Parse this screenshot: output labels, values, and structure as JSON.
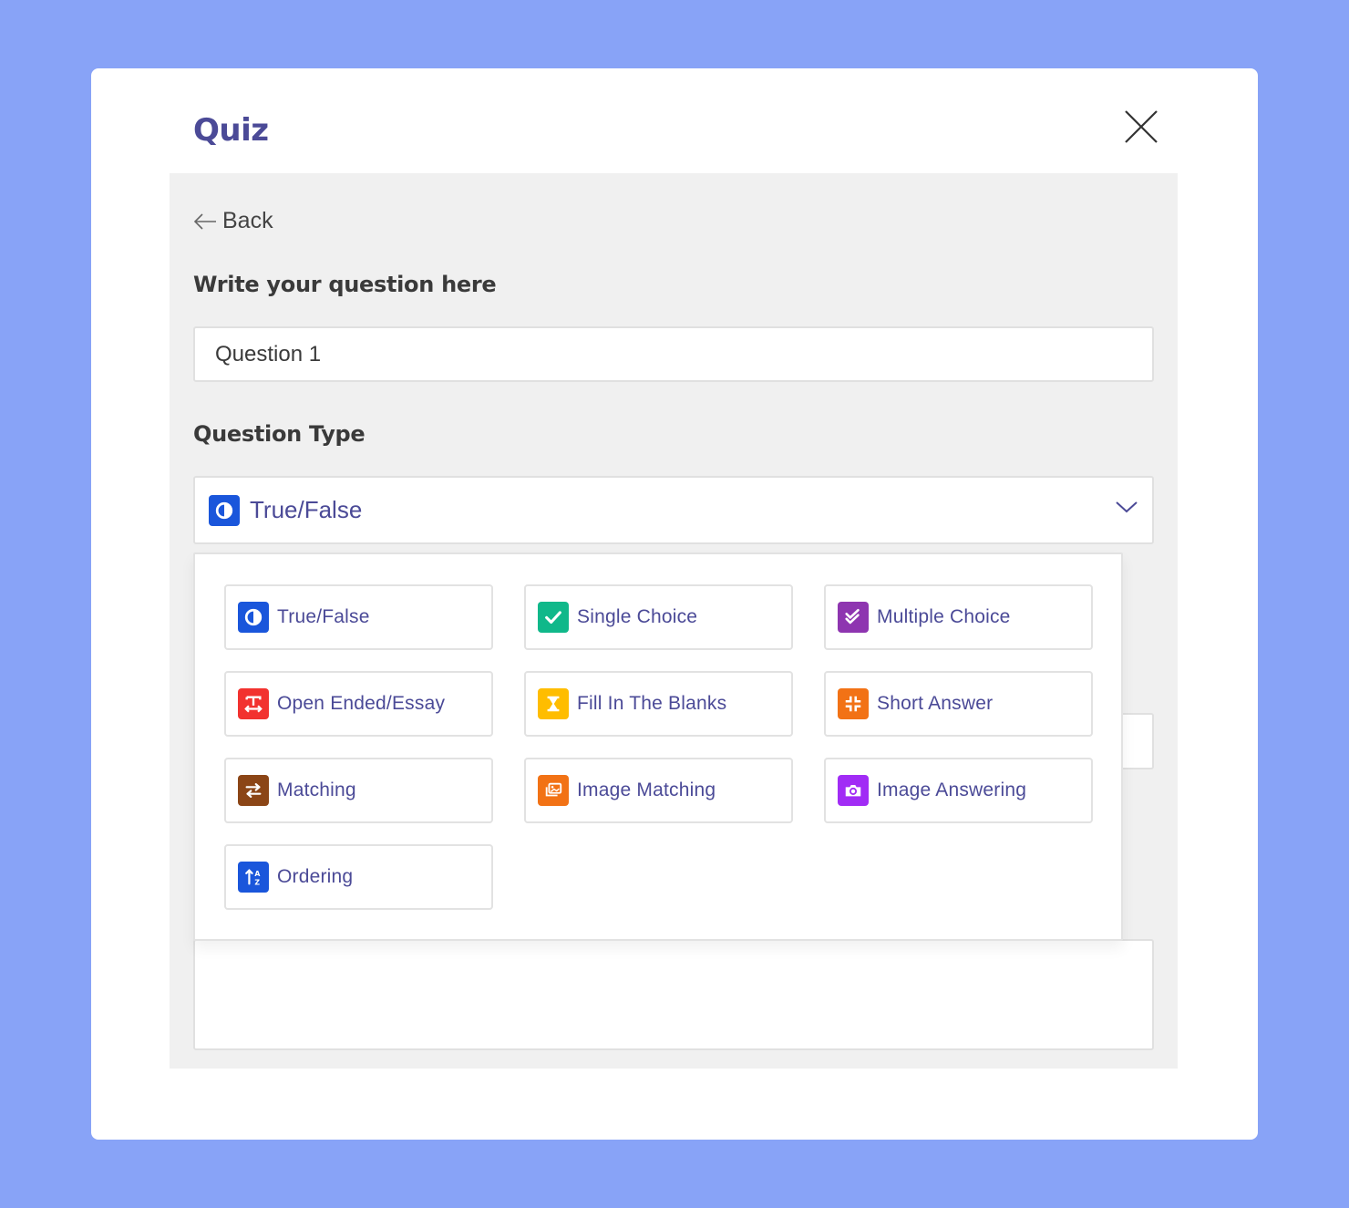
{
  "modal": {
    "title": "Quiz",
    "close_icon": "close-icon"
  },
  "form": {
    "back_label": "Back",
    "question_label": "Write your question here",
    "question_value": "Question 1",
    "type_label": "Question Type",
    "selected_type": {
      "label": "True/False",
      "icon": "half-circle-icon",
      "color": "#1a56db"
    }
  },
  "colors": {
    "background": "#88a3f7",
    "title": "#4b4a97",
    "option_text": "#4b4a97",
    "panel": "#f0f0f0"
  },
  "question_types": [
    {
      "label": "True/False",
      "icon": "half-circle-icon",
      "color": "#1a56db"
    },
    {
      "label": "Single Choice",
      "icon": "check-icon",
      "color": "#10b88a"
    },
    {
      "label": "Multiple Choice",
      "icon": "double-check-icon",
      "color": "#8e35b0"
    },
    {
      "label": "Open Ended/Essay",
      "icon": "text-width-icon",
      "color": "#f2322f"
    },
    {
      "label": "Fill In The Blanks",
      "icon": "hourglass-icon",
      "color": "#ffbd00"
    },
    {
      "label": "Short Answer",
      "icon": "compress-icon",
      "color": "#f27215"
    },
    {
      "label": "Matching",
      "icon": "swap-arrows-icon",
      "color": "#8b4516"
    },
    {
      "label": "Image Matching",
      "icon": "images-icon",
      "color": "#f27215"
    },
    {
      "label": "Image Answering",
      "icon": "camera-icon",
      "color": "#a12cf5"
    },
    {
      "label": "Ordering",
      "icon": "sort-alpha-icon",
      "color": "#1a56db"
    }
  ]
}
